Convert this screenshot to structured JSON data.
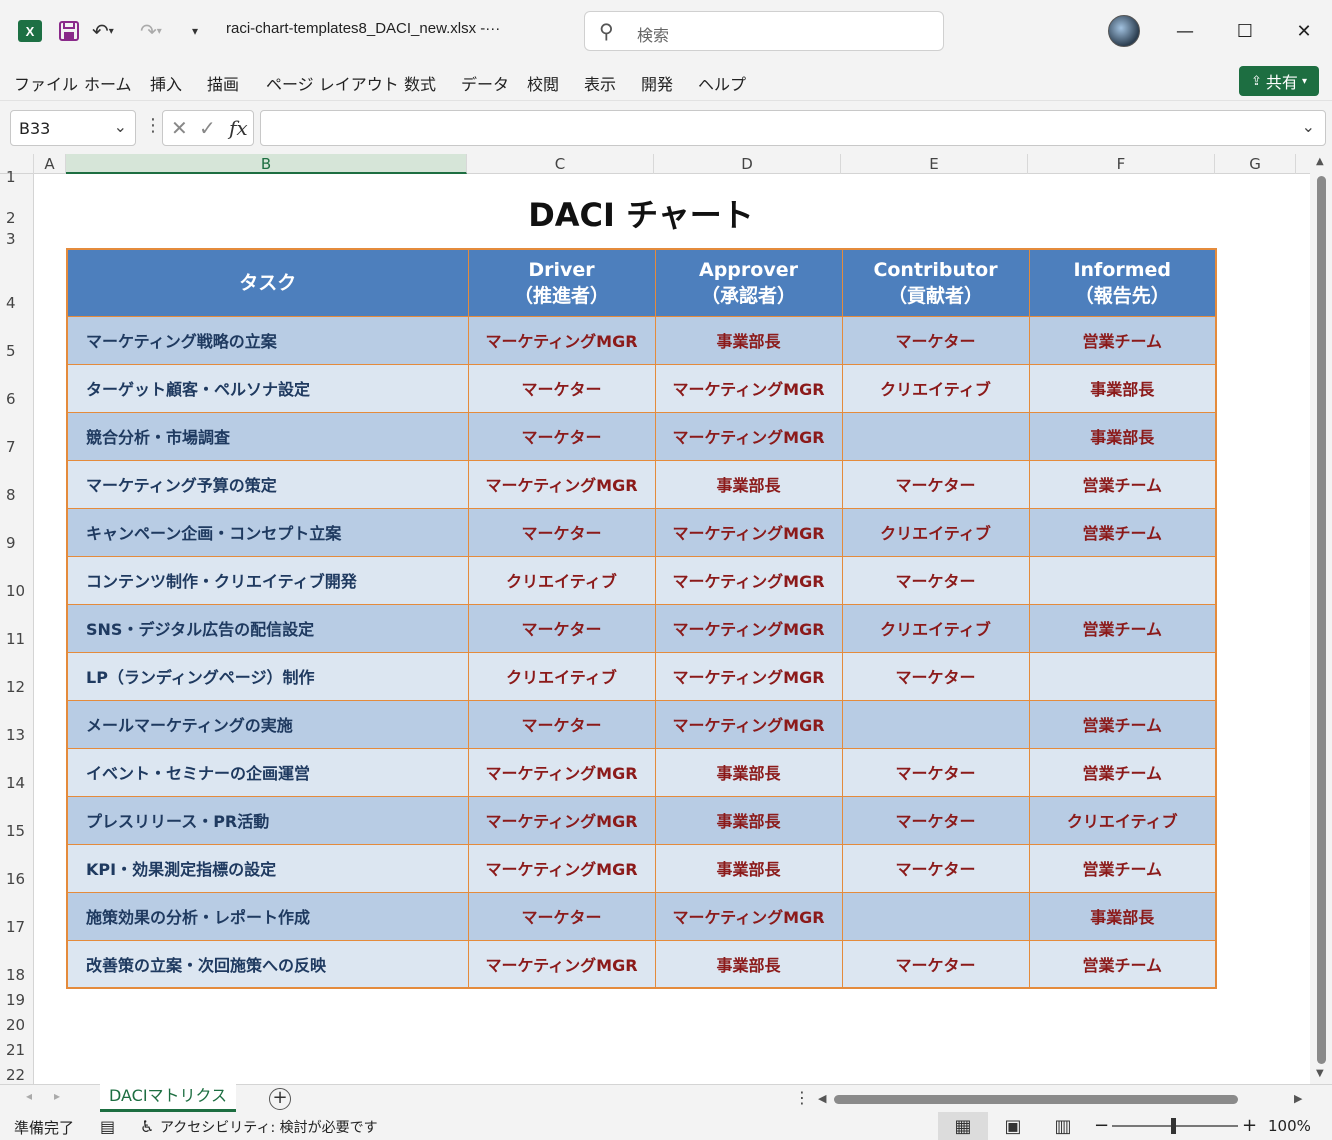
{
  "titlebar": {
    "filename": "raci-chart-templates8_DACI_new.xlsx  -···",
    "search_placeholder": "検索"
  },
  "menu": {
    "items": [
      "ファイル",
      "ホーム",
      "挿入",
      "描画",
      "ページ レイアウト",
      "数式",
      "データ",
      "校閲",
      "表示",
      "開発",
      "ヘルプ"
    ],
    "share_label": "共有"
  },
  "formula_bar": {
    "name_box": "B33",
    "formula": ""
  },
  "columns": [
    "A",
    "B",
    "C",
    "D",
    "E",
    "F",
    "G"
  ],
  "rows": [
    "1",
    "2",
    "3",
    "4",
    "5",
    "6",
    "7",
    "8",
    "9",
    "10",
    "11",
    "12",
    "13",
    "14",
    "15",
    "16",
    "17",
    "18",
    "19",
    "20",
    "21",
    "22"
  ],
  "sheet": {
    "title": "DACI チャート",
    "headers": {
      "task": "タスク",
      "driver": "Driver",
      "driver_jp": "（推進者）",
      "approver": "Approver",
      "approver_jp": "（承認者）",
      "contributor": "Contributor",
      "contributor_jp": "（貢献者）",
      "informed": "Informed",
      "informed_jp": "（報告先）"
    },
    "rows": [
      {
        "task": "マーケティング戦略の立案",
        "driver": "マーケティングMGR",
        "approver": "事業部長",
        "contributor": "マーケター",
        "informed": "営業チーム"
      },
      {
        "task": "ターゲット顧客・ペルソナ設定",
        "driver": "マーケター",
        "approver": "マーケティングMGR",
        "contributor": "クリエイティブ",
        "informed": "事業部長"
      },
      {
        "task": "競合分析・市場調査",
        "driver": "マーケター",
        "approver": "マーケティングMGR",
        "contributor": "",
        "informed": "事業部長"
      },
      {
        "task": "マーケティング予算の策定",
        "driver": "マーケティングMGR",
        "approver": "事業部長",
        "contributor": "マーケター",
        "informed": "営業チーム"
      },
      {
        "task": "キャンペーン企画・コンセプト立案",
        "driver": "マーケター",
        "approver": "マーケティングMGR",
        "contributor": "クリエイティブ",
        "informed": "営業チーム"
      },
      {
        "task": "コンテンツ制作・クリエイティブ開発",
        "driver": "クリエイティブ",
        "approver": "マーケティングMGR",
        "contributor": "マーケター",
        "informed": ""
      },
      {
        "task": "SNS・デジタル広告の配信設定",
        "driver": "マーケター",
        "approver": "マーケティングMGR",
        "contributor": "クリエイティブ",
        "informed": "営業チーム"
      },
      {
        "task": "LP（ランディングページ）制作",
        "driver": "クリエイティブ",
        "approver": "マーケティングMGR",
        "contributor": "マーケター",
        "informed": ""
      },
      {
        "task": "メールマーケティングの実施",
        "driver": "マーケター",
        "approver": "マーケティングMGR",
        "contributor": "",
        "informed": "営業チーム"
      },
      {
        "task": "イベント・セミナーの企画運営",
        "driver": "マーケティングMGR",
        "approver": "事業部長",
        "contributor": "マーケター",
        "informed": "営業チーム"
      },
      {
        "task": "プレスリリース・PR活動",
        "driver": "マーケティングMGR",
        "approver": "事業部長",
        "contributor": "マーケター",
        "informed": "クリエイティブ"
      },
      {
        "task": "KPI・効果測定指標の設定",
        "driver": "マーケティングMGR",
        "approver": "事業部長",
        "contributor": "マーケター",
        "informed": "営業チーム"
      },
      {
        "task": "施策効果の分析・レポート作成",
        "driver": "マーケター",
        "approver": "マーケティングMGR",
        "contributor": "",
        "informed": "事業部長"
      },
      {
        "task": "改善策の立案・次回施策への反映",
        "driver": "マーケティングMGR",
        "approver": "事業部長",
        "contributor": "マーケター",
        "informed": "営業チーム"
      }
    ]
  },
  "tabs": {
    "active_sheet": "DACIマトリクス"
  },
  "status": {
    "ready": "準備完了",
    "accessibility": "アクセシビリティ: 検討が必要です",
    "zoom": "100%"
  },
  "colors": {
    "header_bg": "#4d7fbd",
    "row_dark": "#b8cce4",
    "row_light": "#dce6f1",
    "border": "#e48b3c",
    "role_text": "#8b1a1a",
    "task_text": "#1f3a60",
    "accent": "#1d6e41"
  }
}
